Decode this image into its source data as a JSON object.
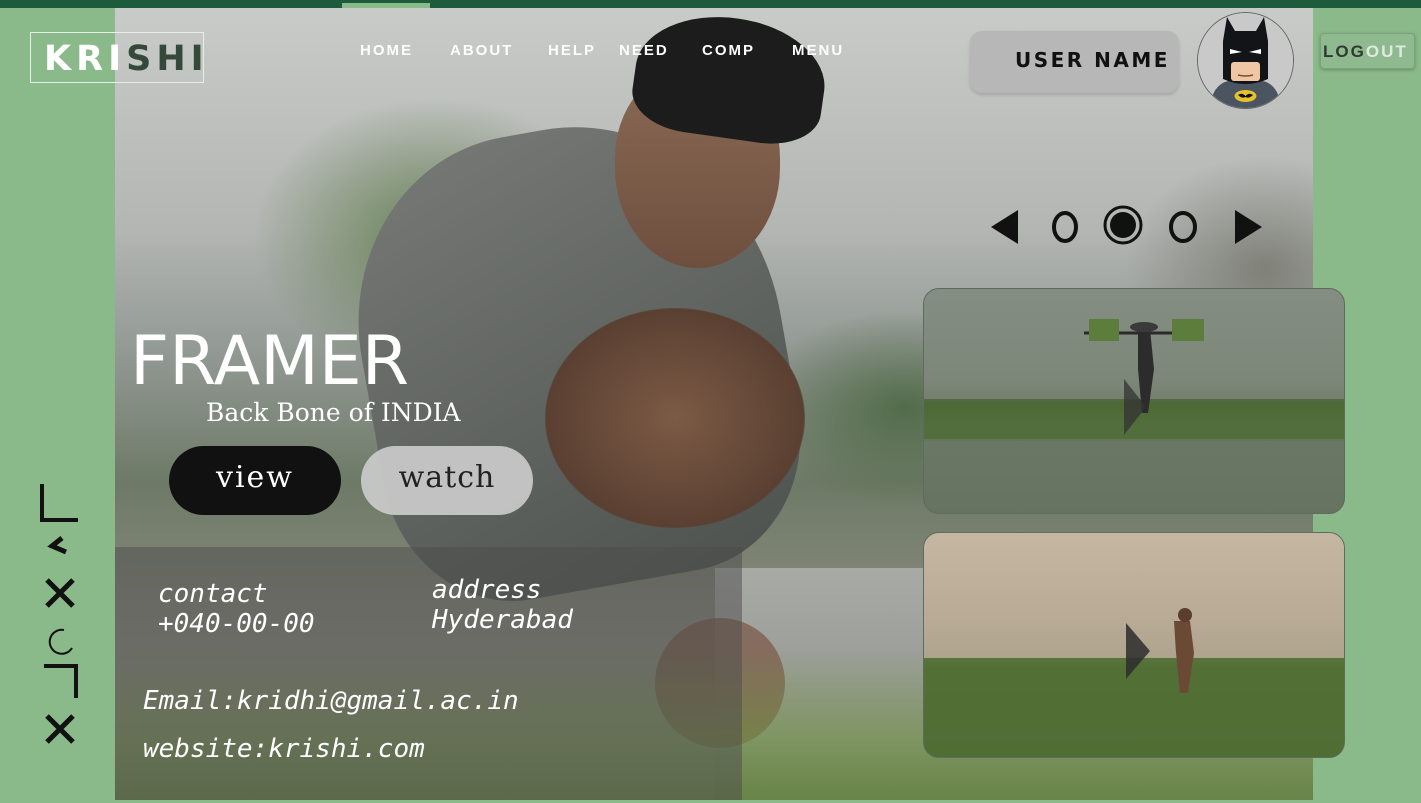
{
  "brand": {
    "logo_main": "KRI",
    "logo_dim": "SHI"
  },
  "nav": {
    "items": [
      {
        "label": "HOME"
      },
      {
        "label": "ABOUT"
      },
      {
        "label": "HELP"
      },
      {
        "label": "NEED"
      },
      {
        "label": "COMP"
      },
      {
        "label": "MENU"
      }
    ]
  },
  "user": {
    "name": "USER NAME",
    "avatar_icon": "batman-avatar-icon"
  },
  "logout": {
    "part1": "LOG",
    "part2": "OUT"
  },
  "carousel": {
    "total_dots": 3,
    "active_index": 1
  },
  "hero": {
    "title": "FRAMER",
    "subtitle": "Back Bone of INDIA",
    "view_label": "view",
    "watch_label": "watch"
  },
  "contact": {
    "contact_label": "contact",
    "phone": "+040-00-00",
    "address_label": "address",
    "city": "Hyderabad",
    "email": "Email:kridhi@gmail.ac.in",
    "website": "website:krishi.com"
  },
  "colors": {
    "side_green": "#8ab98a",
    "top_bar": "#1d5b3c",
    "view_button": "#111111",
    "watch_button": "#cfcfcf"
  }
}
